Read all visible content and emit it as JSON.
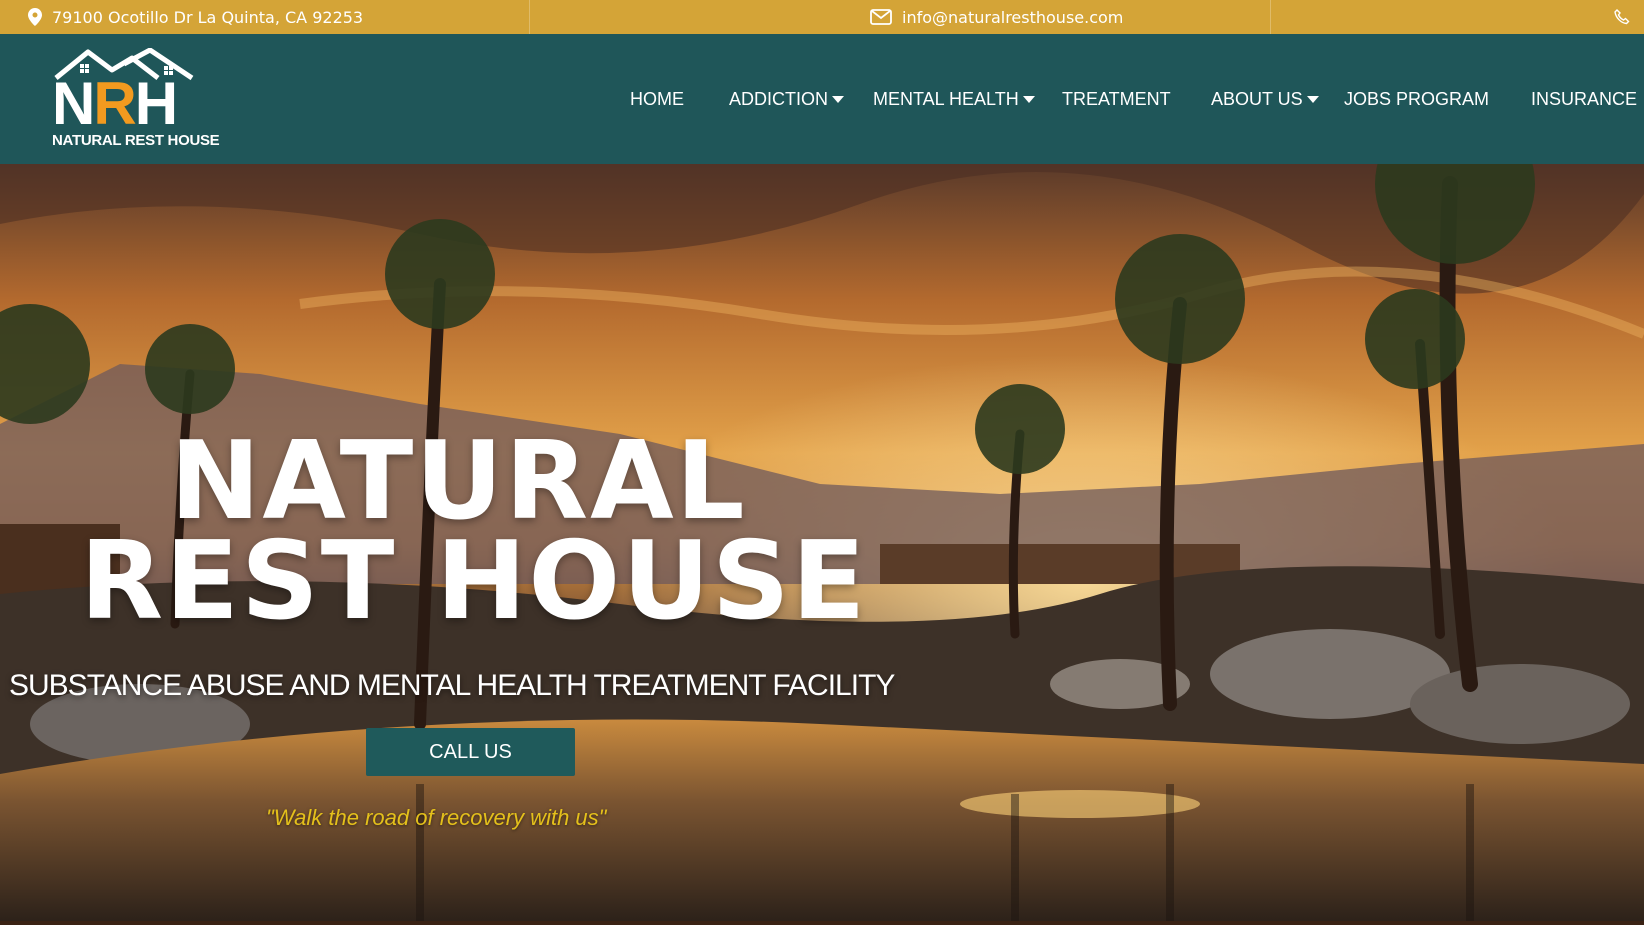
{
  "colors": {
    "topbar_bg": "#d4a437",
    "header_bg": "#1f5659",
    "logo_accent": "#f29a1f",
    "cta_bg": "#1f5a5b",
    "tagline": "#e4c01b"
  },
  "topbar": {
    "address": "79100 Ocotillo Dr La Quinta, CA 92253",
    "address_icon": "map-pin-icon",
    "email": "info@naturalresthouse.com",
    "email_icon": "mail-icon",
    "phone_icon": "phone-icon"
  },
  "logo": {
    "letters_n": "N",
    "letters_r": "R",
    "letters_h": "H",
    "subtitle": "NATURAL REST HOUSE"
  },
  "nav": {
    "items": [
      {
        "label": "HOME",
        "dropdown": false
      },
      {
        "label": "ADDICTION",
        "dropdown": true
      },
      {
        "label": "MENTAL HEALTH",
        "dropdown": true
      },
      {
        "label": "TREATMENT",
        "dropdown": false
      },
      {
        "label": "ABOUT US",
        "dropdown": true
      },
      {
        "label": "JOBS PROGRAM",
        "dropdown": false
      },
      {
        "label": "INSURANCE",
        "dropdown": false
      }
    ]
  },
  "hero": {
    "headline_line1": "NATURAL",
    "headline_line2": "REST HOUSE",
    "subtitle": "SUBSTANCE ABUSE AND MENTAL HEALTH TREATMENT FACILITY",
    "cta_label": "CALL US",
    "tagline": "\"Walk the road of recovery with us\""
  }
}
